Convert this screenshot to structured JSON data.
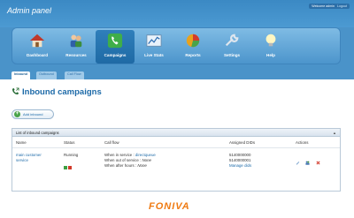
{
  "header": {
    "title": "Admin panel",
    "welcome": "Welcome admin",
    "logout": "Logout"
  },
  "nav": {
    "items": [
      {
        "label": "Dashboard",
        "icon": "house-icon"
      },
      {
        "label": "Resources",
        "icon": "users-icon"
      },
      {
        "label": "Campaigns",
        "icon": "phone-icon",
        "active": true
      },
      {
        "label": "Live Stats",
        "icon": "chart-icon"
      },
      {
        "label": "Reports",
        "icon": "pie-chart-icon"
      },
      {
        "label": "Settings",
        "icon": "wrench-icon"
      },
      {
        "label": "Help",
        "icon": "lightbulb-icon"
      }
    ]
  },
  "subtabs": [
    {
      "label": "Inbound",
      "active": true
    },
    {
      "label": "Outbound"
    },
    {
      "label": "Call Flow"
    }
  ],
  "page": {
    "title": "Inbound campaigns",
    "add_button": "Add inbound"
  },
  "table": {
    "caption": "List of inbound campaigns",
    "columns": [
      "Name",
      "Status",
      "Call flow",
      "Assigned DIDs",
      "Actions"
    ],
    "rows": [
      {
        "name_line1": "main customer",
        "name_line2": "service",
        "status": "Running",
        "flow_service_label": "When in service :",
        "flow_service_value": "directqueue",
        "flow_out_label": "When out of service :",
        "flow_out_value": "None",
        "flow_after_label": "When after hours :",
        "flow_after_value": "None",
        "did1": "5140000000",
        "did2": "5140000001",
        "manage": "Manage dids"
      }
    ]
  },
  "footer": {
    "logo": "FONIVA"
  },
  "colors": {
    "header_blue": "#3b89c4",
    "title_blue": "#1d6aa8",
    "logo_orange": "#ef7b13"
  }
}
